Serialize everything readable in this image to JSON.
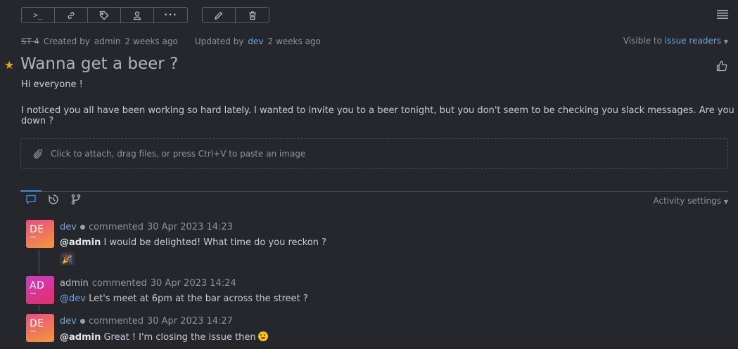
{
  "toolbar": {
    "group1": [
      {
        "icon": "terminal-icon",
        "glyph": ">_"
      },
      {
        "icon": "link-icon"
      },
      {
        "icon": "tag-icon"
      },
      {
        "icon": "user-icon"
      },
      {
        "icon": "more-icon",
        "glyph": "•••"
      }
    ],
    "group2": [
      {
        "icon": "edit-icon"
      },
      {
        "icon": "delete-icon"
      }
    ]
  },
  "meta": {
    "issue_id": "ST-4",
    "created_label": "Created by",
    "created_by": "admin",
    "created_when": "2 weeks ago",
    "updated_label": "Updated by",
    "updated_by": "dev",
    "updated_when": "2 weeks ago",
    "visible_label": "Visible to",
    "visible_value": "issue readers"
  },
  "issue": {
    "title": "Wanna get a beer ?",
    "starred": true,
    "description": [
      "Hi everyone !",
      "I noticed you all have been working so hard lately. I wanted to invite you to a beer tonight, but you don't seem to be checking you slack messages. Are you down ?"
    ],
    "attach_hint": "Click to attach, drag files, or press Ctrl+V to paste an image"
  },
  "activity": {
    "tabs": [
      "comments-tab",
      "history-tab",
      "vcs-tab"
    ],
    "active_tab": "comments-tab",
    "settings_label": "Activity settings"
  },
  "comments": [
    {
      "initials": "DE",
      "author": "dev",
      "action": "commented",
      "time": "30 Apr 2023 14:23",
      "mention": "@admin",
      "text": " I would be delighted! What time do you reckon ?",
      "reaction": "🎉"
    },
    {
      "initials": "AD",
      "author": "admin",
      "action": "commented",
      "time": "30 Apr 2023 14:24",
      "mention": "@dev",
      "text": " Let's meet at 6pm at the bar across the street ?"
    },
    {
      "initials": "DE",
      "author": "dev",
      "action": "commented",
      "time": "30 Apr 2023 14:27",
      "mention": "@admin",
      "text": " Great ! I'm closing the issue then"
    }
  ],
  "colors": {
    "background": "#25272d",
    "link": "#6fa8dc",
    "accent": "#3d8bd9",
    "star": "#e0a22e"
  }
}
